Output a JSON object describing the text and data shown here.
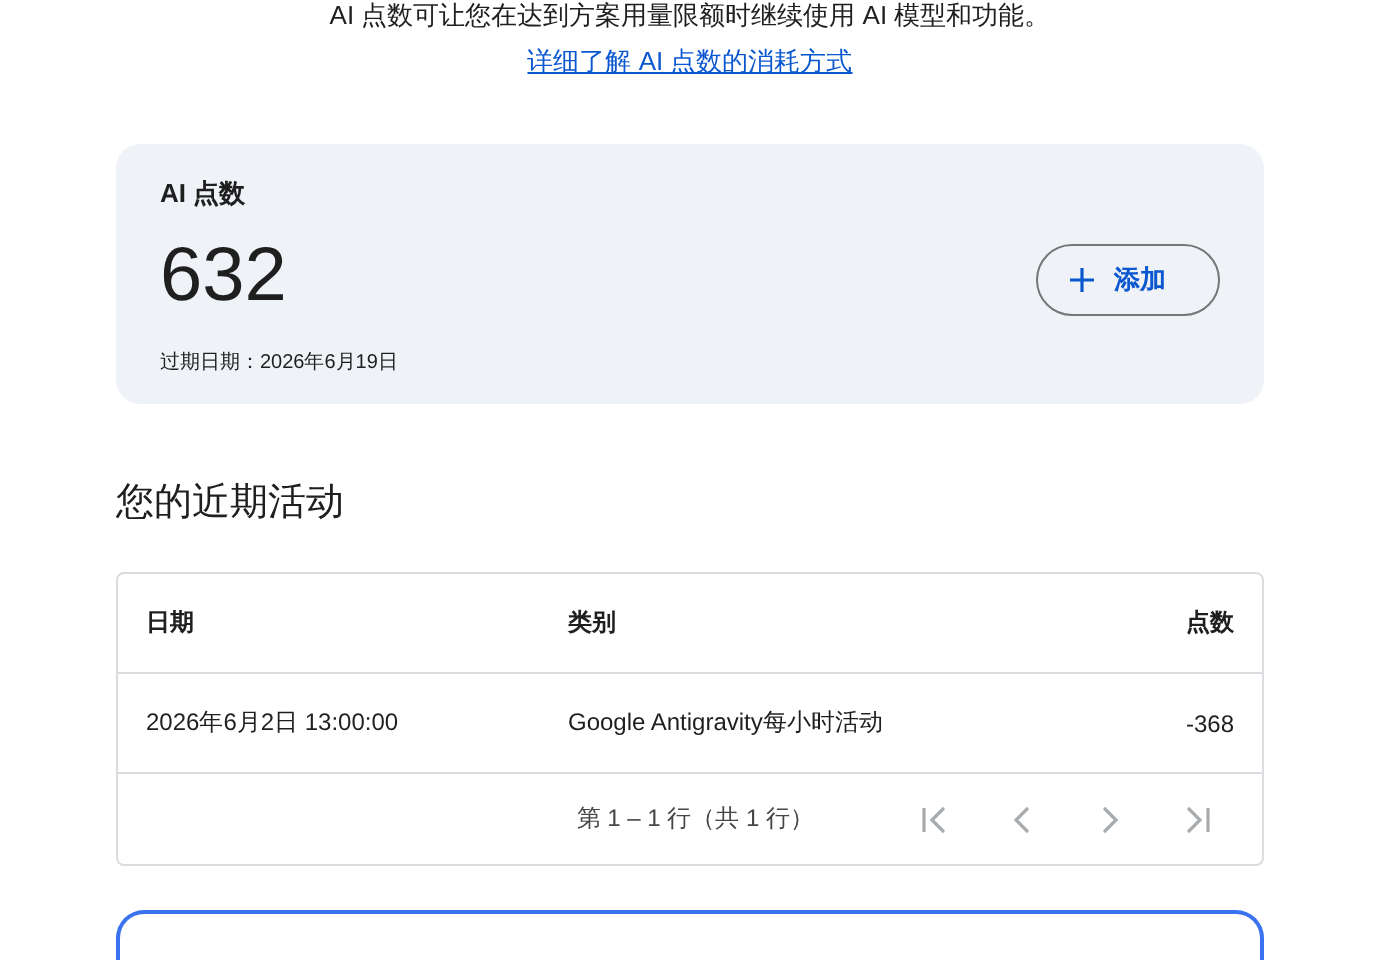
{
  "intro": {
    "text": "AI 点数可让您在达到方案用量限额时继续使用 AI 模型和功能。",
    "link": "详细了解 AI 点数的消耗方式"
  },
  "credits_card": {
    "title": "AI 点数",
    "balance": "632",
    "expiry": "过期日期：2026年6月19日",
    "add_button": "添加"
  },
  "activity": {
    "heading": "您的近期活动",
    "table": {
      "columns": [
        "日期",
        "类别",
        "点数"
      ],
      "rows": [
        [
          "2026年6月2日 13:00:00",
          "Google Antigravity每小时活动",
          "-368"
        ]
      ],
      "pagination": {
        "range": "第 1 – 1 行（共 1 行）",
        "buttons": [
          {
            "kind": "first",
            "disabled": true
          },
          {
            "kind": "prev",
            "disabled": true
          },
          {
            "kind": "next",
            "disabled": true
          },
          {
            "kind": "last",
            "disabled": true
          }
        ]
      }
    }
  }
}
